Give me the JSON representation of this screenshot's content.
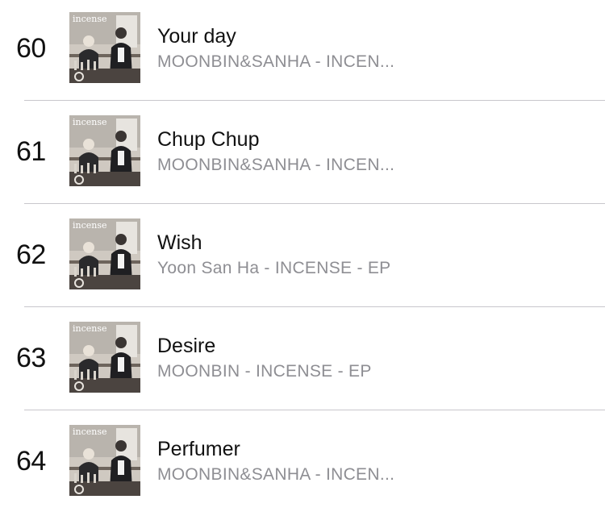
{
  "colors": {
    "text_primary": "#111111",
    "text_secondary": "#8e8e93",
    "separator": "#c8c7cc",
    "background": "#ffffff"
  },
  "cover_art": {
    "icon": "album-cover",
    "wordmark": "incense"
  },
  "tracks": [
    {
      "rank": "60",
      "title": "Your day",
      "subtitle": "MOONBIN&SANHA - INCEN..."
    },
    {
      "rank": "61",
      "title": "Chup Chup",
      "subtitle": "MOONBIN&SANHA - INCEN..."
    },
    {
      "rank": "62",
      "title": "Wish",
      "subtitle": "Yoon San Ha - INCENSE - EP"
    },
    {
      "rank": "63",
      "title": "Desire",
      "subtitle": "MOONBIN - INCENSE - EP"
    },
    {
      "rank": "64",
      "title": "Perfumer",
      "subtitle": "MOONBIN&SANHA - INCEN..."
    }
  ]
}
